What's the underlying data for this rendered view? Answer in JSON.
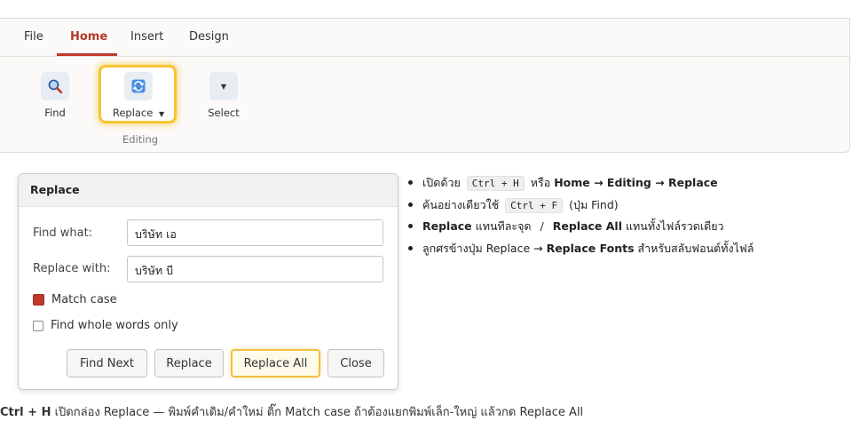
{
  "ribbon": {
    "tabs": [
      "File",
      "Home",
      "Insert",
      "Design"
    ],
    "active_tab": "Home",
    "tools": {
      "find": "Find",
      "replace": "Replace",
      "select": "Select"
    },
    "group_label": "Editing"
  },
  "dialog": {
    "title": "Replace",
    "find_label": "Find what:",
    "find_value": "บริษัท เอ",
    "replace_label": "Replace with:",
    "replace_value": "บริษัท บี",
    "match_case": "Match case",
    "match_case_checked": true,
    "whole_words": "Find whole words only",
    "whole_words_checked": false,
    "buttons": {
      "find_next": "Find Next",
      "replace": "Replace",
      "replace_all": "Replace All",
      "close": "Close"
    }
  },
  "notes": {
    "n1": {
      "pre": "เปิดด้วย",
      "kbd": "Ctrl + H",
      "mid": "หรือ",
      "path": "Home → Editing → Replace"
    },
    "n2": {
      "pre": "ค้นอย่างเดียวใช้",
      "kbd": "Ctrl + F",
      "post": "(ปุ่ม Find)"
    },
    "n3": {
      "b1": "Replace",
      "t1": "แทนทีละจุด",
      "sep": "/",
      "b2": "Replace All",
      "t2": "แทนทั้งไฟล์รวดเดียว"
    },
    "n4": {
      "pre": "ลูกศรข้างปุ่ม Replace →",
      "b": "Replace Fonts",
      "post": "สำหรับสลับฟอนต์ทั้งไฟล์"
    }
  },
  "footer": {
    "bold": "Ctrl + H",
    "text": "เปิดกล่อง Replace — พิมพ์คำเดิม/คำใหม่ ติ๊ก Match case ถ้าต้องแยกพิมพ์เล็ก-ใหญ่ แล้วกด Replace All"
  },
  "colors": {
    "accent": "#c0392b",
    "highlight": "#f6c431"
  },
  "icons": [
    "magnifier-icon",
    "replace-arrows-icon",
    "caret-down-icon"
  ]
}
